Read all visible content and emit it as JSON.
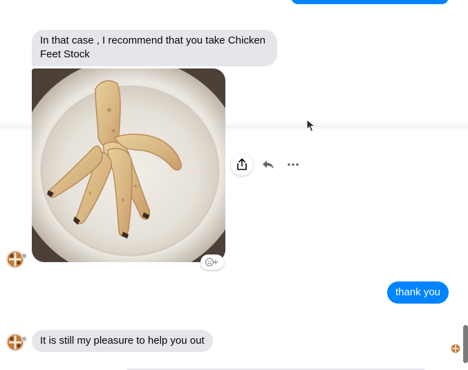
{
  "conversation": {
    "messages": [
      {
        "sender": "contact",
        "type": "text",
        "text": "In that case , I recommend that you take Chicken Feet Stock"
      },
      {
        "sender": "contact",
        "type": "image",
        "image_subject": "chicken feet on a white plate"
      },
      {
        "sender": "me",
        "type": "text",
        "text": "thank you"
      },
      {
        "sender": "contact",
        "type": "text",
        "text": "It is still my pleasure to help you out"
      }
    ]
  },
  "hover_actions": {
    "share_icon": "share-icon",
    "reply_icon": "reply-icon",
    "more_icon": "more-options-icon",
    "reaction_icon": "add-reaction-icon"
  },
  "colors": {
    "sent_bubble": "#0084ff",
    "received_bubble": "#e4e6eb",
    "icon_gray": "#65676b"
  }
}
